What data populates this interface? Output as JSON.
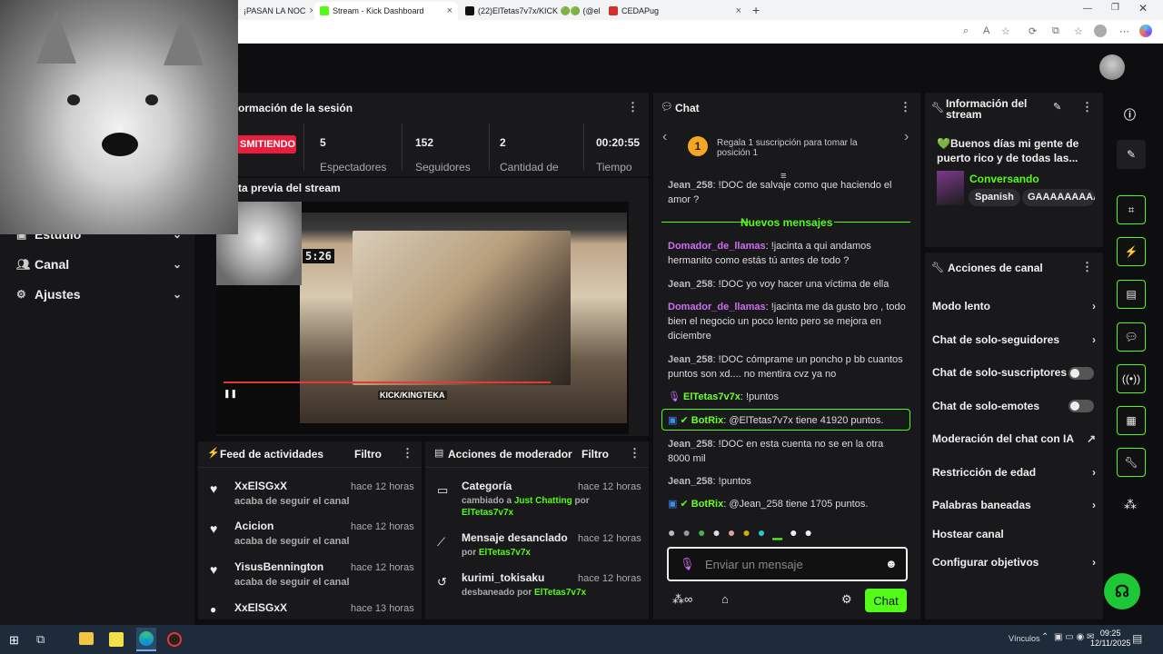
{
  "browser": {
    "tabs": [
      {
        "label": "¡PASAN LA NOC",
        "active": false
      },
      {
        "label": "Stream - Kick Dashboard",
        "active": true
      },
      {
        "label": "(22)ElTetas7v7x/KICK 🟢🟢 (@elt",
        "active": false
      },
      {
        "label": "CEDAPug",
        "active": false
      }
    ]
  },
  "sidebar": {
    "items": [
      {
        "label": "Estudio",
        "icon": "studio-icon"
      },
      {
        "label": "Canal",
        "icon": "users-icon"
      },
      {
        "label": "Ajustes",
        "icon": "gear-icon"
      }
    ]
  },
  "session": {
    "title": "ormación de la sesión",
    "live_badge": "SMITIENDO",
    "stats": [
      {
        "value": "5",
        "label": "Espectadores"
      },
      {
        "value": "152",
        "label": "Seguidores"
      },
      {
        "value": "2",
        "label": "Cantidad de"
      },
      {
        "value": "00:20:55",
        "label": "Tiempo"
      }
    ]
  },
  "preview": {
    "title": "ta previa del stream",
    "timer": "5:26",
    "overlay_text": "KICK/KINGTEKA"
  },
  "feed": {
    "title": "Feed de actividades",
    "filter": "Filtro",
    "items": [
      {
        "name": "XxElSGxX",
        "sub": "acaba de seguir el canal",
        "time": "hace 12 horas"
      },
      {
        "name": "Acicion",
        "sub": "acaba de seguir el canal",
        "time": "hace 12 horas"
      },
      {
        "name": "YisusBennington",
        "sub": "acaba de seguir el canal",
        "time": "hace 12 horas"
      },
      {
        "name": "XxElSGxX",
        "sub": "",
        "time": "hace 13 horas"
      }
    ]
  },
  "modactions": {
    "title": "Acciones de moderador",
    "filter": "Filtro",
    "items": [
      {
        "name": "Categoría",
        "pre": "cambiado a ",
        "hl": "Just Chatting",
        "mid": " por",
        "user": "ElTetas7v7x",
        "time": "hace 12 horas"
      },
      {
        "name": "Mensaje desanclado",
        "pre": "por ",
        "hl": "",
        "mid": "",
        "user": "ElTetas7v7x",
        "time": "hace 12 horas"
      },
      {
        "name": "kurimi_tokisaku",
        "pre": "desbaneado por ",
        "hl": "",
        "mid": "",
        "user": "ElTetas7v7x",
        "time": "hace 12 horas"
      }
    ]
  },
  "chat": {
    "title": "Chat",
    "goal_rank": "1",
    "goal_text": "Regala 1 suscripción para tomar la posición 1",
    "new_messages": "Nuevos mensajes",
    "input_placeholder": "Enviar un mensaje",
    "send_label": "Chat",
    "messages": [
      {
        "user": "Jean_258",
        "text": ": !DOC de salvaje como que haciendo el amor ?"
      },
      {
        "user": "Domador_de_llamas",
        "text": ": !jacinta a qui andamos hermanito como estás tú antes de todo ?"
      },
      {
        "user": "Jean_258",
        "text": ": !DOC yo voy hacer una víctima de ella"
      },
      {
        "user": "Domador_de_llamas",
        "text": ": !jacinta me da gusto bro , todo bien el negocio un poco lento pero se mejora en diciembre"
      },
      {
        "user": "Jean_258",
        "text": ": !DOC cómprame un poncho p bb cuantos puntos son xd.... no mentira cvz ya no"
      },
      {
        "user": "ElTetas7v7x",
        "text": ": !puntos"
      },
      {
        "user": "BotRix",
        "text": ": @ElTetas7v7x tiene 41920 puntos."
      },
      {
        "user": "Jean_258",
        "text": ": !DOC en esta cuenta no se en la otra 8000 mil"
      },
      {
        "user": "Jean_258",
        "text": ": !puntos"
      },
      {
        "user": "BotRix",
        "text": ": @Jean_258 tiene 1705 puntos."
      }
    ]
  },
  "streaminfo": {
    "title": "Información del stream",
    "stream_title": "💚Buenos días mi gente de puerto rico y de todas las...",
    "category": "Conversando",
    "tags": [
      "Spanish",
      "GAAAAAAAAA"
    ]
  },
  "channelactions": {
    "title": "Acciones de canal",
    "items": [
      {
        "label": "Modo lento",
        "control": "chevron"
      },
      {
        "label": "Chat de solo-seguidores",
        "control": "chevron"
      },
      {
        "label": "Chat de solo-suscriptores",
        "control": "toggle"
      },
      {
        "label": "Chat de solo-emotes",
        "control": "toggle"
      },
      {
        "label": "Moderación del chat con IA",
        "control": "external"
      },
      {
        "label": "Restricción de edad",
        "control": "chevron"
      },
      {
        "label": "Palabras baneadas",
        "control": "chevron"
      },
      {
        "label": "Hostear canal",
        "control": "none"
      },
      {
        "label": "Configurar objetivos",
        "control": "chevron"
      }
    ]
  },
  "taskbar": {
    "tray_label": "Vínculos",
    "time": "09:25",
    "date": "12/11/2025"
  },
  "colors": {
    "accent": "#53fc18",
    "live": "#e91e3c",
    "bg": "#0e0e10",
    "panel": "#19191c"
  }
}
